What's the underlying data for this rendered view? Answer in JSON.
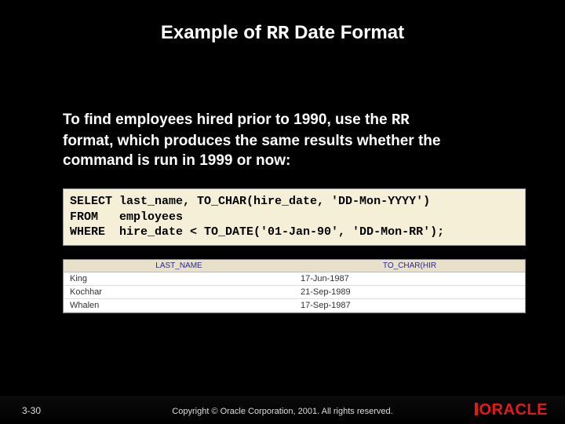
{
  "title": {
    "prefix": "Example of ",
    "code": "RR",
    "suffix": " Date Format"
  },
  "body": {
    "line1_prefix": "To find employees hired prior to 1990, use the ",
    "line1_code": "RR",
    "line2": "format, which produces the same results whether the",
    "line3": "command is run in 1999 or now:"
  },
  "sql": "SELECT last_name, TO_CHAR(hire_date, 'DD-Mon-YYYY')\nFROM   employees\nWHERE  hire_date < TO_DATE('01-Jan-90', 'DD-Mon-RR');",
  "table": {
    "headers": [
      "LAST_NAME",
      "TO_CHAR(HIR"
    ],
    "rows": [
      {
        "c1": "King",
        "c2": "17-Jun-1987"
      },
      {
        "c1": "Kochhar",
        "c2": "21-Sep-1989"
      },
      {
        "c1": "Whalen",
        "c2": "17-Sep-1987"
      }
    ]
  },
  "footer": {
    "page": "3-30",
    "copyright": "Copyright © Oracle Corporation, 2001. All rights reserved.",
    "logo": "ORACLE"
  }
}
